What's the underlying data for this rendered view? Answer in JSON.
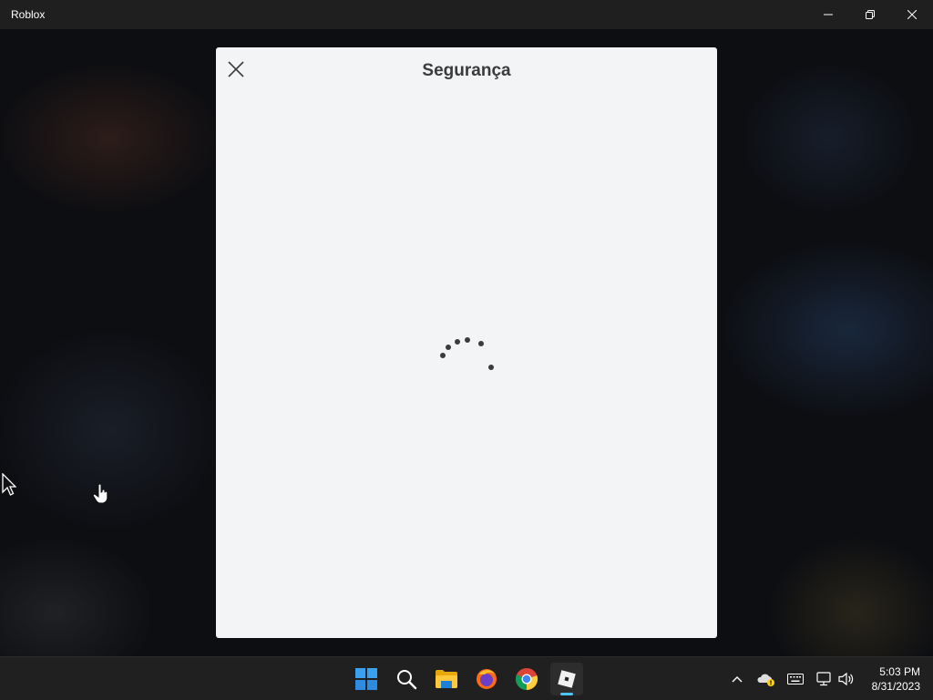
{
  "window": {
    "title": "Roblox",
    "buttons": [
      "minimize",
      "restore",
      "close"
    ]
  },
  "dialog": {
    "title": "Segurança",
    "close_icon": "close-icon",
    "state": "loading",
    "spinner_icon": "loading-spinner-icon"
  },
  "taskbar": {
    "apps": [
      {
        "name": "Start",
        "icon": "windows-start-icon",
        "active": false
      },
      {
        "name": "Search",
        "icon": "search-icon",
        "active": false
      },
      {
        "name": "File Explorer",
        "icon": "folder-icon",
        "active": false
      },
      {
        "name": "Firefox",
        "icon": "firefox-icon",
        "active": false
      },
      {
        "name": "Chrome",
        "icon": "chrome-icon",
        "active": false
      },
      {
        "name": "Roblox",
        "icon": "roblox-icon",
        "active": true
      }
    ],
    "tray": {
      "icons": [
        "chevron-up-icon",
        "onedrive-warning-icon",
        "keyboard-icon",
        "network-icon",
        "volume-icon"
      ]
    },
    "clock": {
      "time": "5:03 PM",
      "date": "8/31/2023"
    }
  },
  "colors": {
    "accent": "#4cc2ff",
    "dialog_bg": "#f2f4f5",
    "dialog_text": "#393b3d"
  }
}
